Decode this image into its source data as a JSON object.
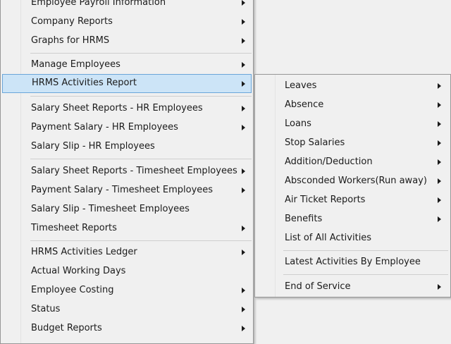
{
  "main_menu": {
    "items": [
      {
        "label": "Employee Payroll Information",
        "has_submenu": true
      },
      {
        "label": "Company Reports",
        "has_submenu": true
      },
      {
        "label": "Graphs for HRMS",
        "has_submenu": true
      },
      {
        "label": "Manage Employees",
        "has_submenu": true
      },
      {
        "label": "HRMS Activities Report",
        "has_submenu": true,
        "highlighted": true
      },
      {
        "label": "Salary Sheet Reports - HR Employees",
        "has_submenu": true
      },
      {
        "label": "Payment Salary - HR Employees",
        "has_submenu": true
      },
      {
        "label": "Salary Slip - HR Employees",
        "has_submenu": false
      },
      {
        "label": "Salary Sheet  Reports - Timesheet Employees",
        "has_submenu": true
      },
      {
        "label": "Payment Salary - Timesheet Employees",
        "has_submenu": true
      },
      {
        "label": "Salary Slip - Timesheet Employees",
        "has_submenu": false
      },
      {
        "label": "Timesheet Reports",
        "has_submenu": true
      },
      {
        "label": "HRMS Activities Ledger",
        "has_submenu": true
      },
      {
        "label": "Actual Working Days",
        "has_submenu": false
      },
      {
        "label": "Employee Costing",
        "has_submenu": true
      },
      {
        "label": "Status",
        "has_submenu": true
      },
      {
        "label": "Budget Reports",
        "has_submenu": true
      }
    ]
  },
  "submenu": {
    "items": [
      {
        "label": "Leaves",
        "has_submenu": true
      },
      {
        "label": "Absence",
        "has_submenu": true
      },
      {
        "label": "Loans",
        "has_submenu": true
      },
      {
        "label": "Stop Salaries",
        "has_submenu": true
      },
      {
        "label": "Addition/Deduction",
        "has_submenu": true
      },
      {
        "label": "Absconded Workers(Run away)",
        "has_submenu": true
      },
      {
        "label": "Air Ticket Reports",
        "has_submenu": true
      },
      {
        "label": "Benefits",
        "has_submenu": true
      },
      {
        "label": "List of All Activities",
        "has_submenu": false
      },
      {
        "label": "Latest Activities By Employee",
        "has_submenu": false
      },
      {
        "label": "End of Service",
        "has_submenu": true
      }
    ]
  },
  "colors": {
    "menu_background": "#f0f0f0",
    "highlight_fill": "#cce4f7",
    "highlight_border": "#6aa5d9",
    "separator": "#cfcfcf"
  }
}
